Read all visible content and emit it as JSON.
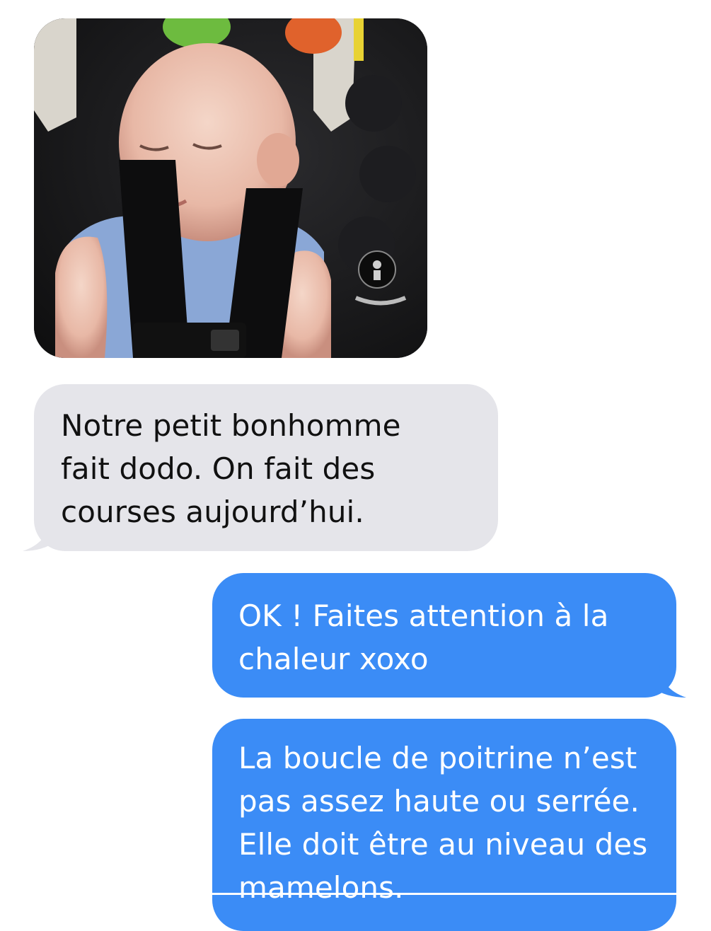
{
  "conversation": {
    "photo": {
      "alt": "photo"
    },
    "messages": [
      {
        "direction": "incoming",
        "text": "Notre petit bonhomme fait dodo. On fait des courses aujourd’hui."
      },
      {
        "direction": "outgoing",
        "text": "OK ! Faites attention à la chaleur xoxo"
      },
      {
        "direction": "outgoing",
        "text": "La boucle de poitrine n’est pas assez haute ou serrée. Elle doit être au niveau des mamelons."
      }
    ],
    "colors": {
      "incoming_bubble": "#e5e5ea",
      "outgoing_bubble": "#3b8cf6",
      "incoming_text": "#111111",
      "outgoing_text": "#ffffff"
    }
  }
}
